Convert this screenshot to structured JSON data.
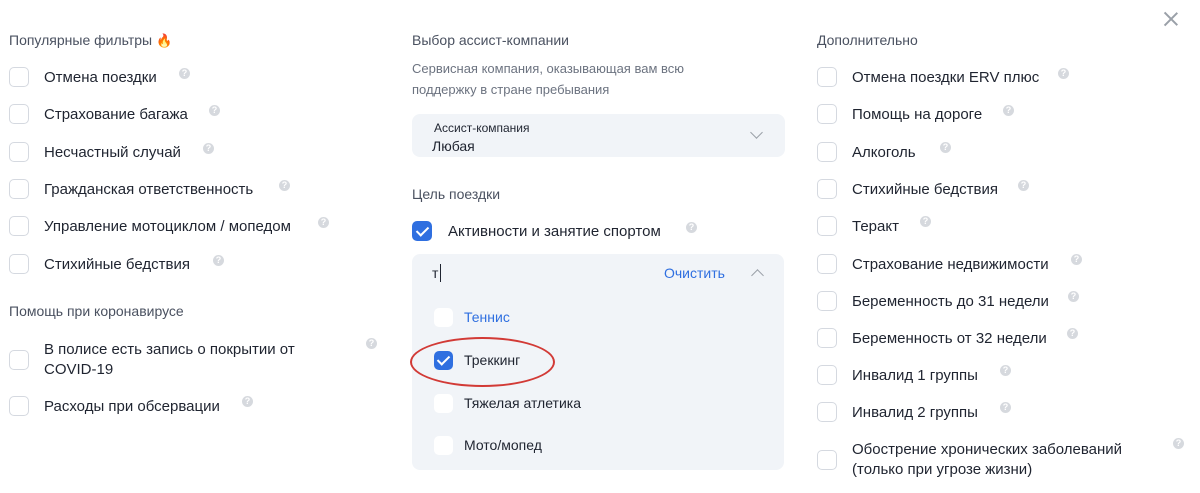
{
  "popular": {
    "title": "Популярные фильтры",
    "items": [
      {
        "label": "Отмена поездки"
      },
      {
        "label": "Страхование багажа"
      },
      {
        "label": "Несчастный случай"
      },
      {
        "label": "Гражданская ответственность"
      },
      {
        "label": "Управление мотоциклом / мопедом"
      },
      {
        "label": "Стихийные бедствия"
      }
    ]
  },
  "covid": {
    "title": "Помощь при коронавирусе",
    "items": [
      {
        "line1": "В полисе есть запись о покрытии от",
        "line2": "COVID-19"
      },
      {
        "label": "Расходы при обсервации"
      }
    ]
  },
  "assist": {
    "title": "Выбор ассист-компании",
    "description_line1": "Сервисная компания, оказывающая вам всю",
    "description_line2": "поддержку в стране пребывания",
    "field_label": "Ассист-компания",
    "value": "Любая"
  },
  "purpose": {
    "title": "Цель поездки",
    "selected_label": "Активности и занятие спортом",
    "search_value": "т",
    "clear_label": "Очистить",
    "options": [
      {
        "label": "Теннис",
        "checked": false
      },
      {
        "label": "Треккинг",
        "checked": true
      },
      {
        "label": "Тяжелая атлетика",
        "checked": false
      },
      {
        "label": "Мото/мопед",
        "checked": false
      }
    ]
  },
  "extra": {
    "title": "Дополнительно",
    "items": [
      {
        "label": "Отмена поездки ERV плюс"
      },
      {
        "label": "Помощь на дороге"
      },
      {
        "label": "Алкоголь"
      },
      {
        "label": "Стихийные бедствия"
      },
      {
        "label": "Теракт"
      },
      {
        "label": "Страхование недвижимости"
      },
      {
        "label": "Беременность до 31 недели"
      },
      {
        "label": "Беременность от 32 недели"
      },
      {
        "label": "Инвалид 1 группы"
      },
      {
        "label": "Инвалид 2 группы"
      },
      {
        "line1": "Обострение хронических заболеваний",
        "line2": "(только при угрозе жизни)"
      }
    ]
  },
  "icons": {
    "help": "question-mark-icon",
    "close": "close-icon",
    "fire": "fire-icon"
  },
  "colors": {
    "accent": "#2f6fe0",
    "highlight_circle": "#d23a36",
    "field_bg": "#f1f4f8"
  }
}
